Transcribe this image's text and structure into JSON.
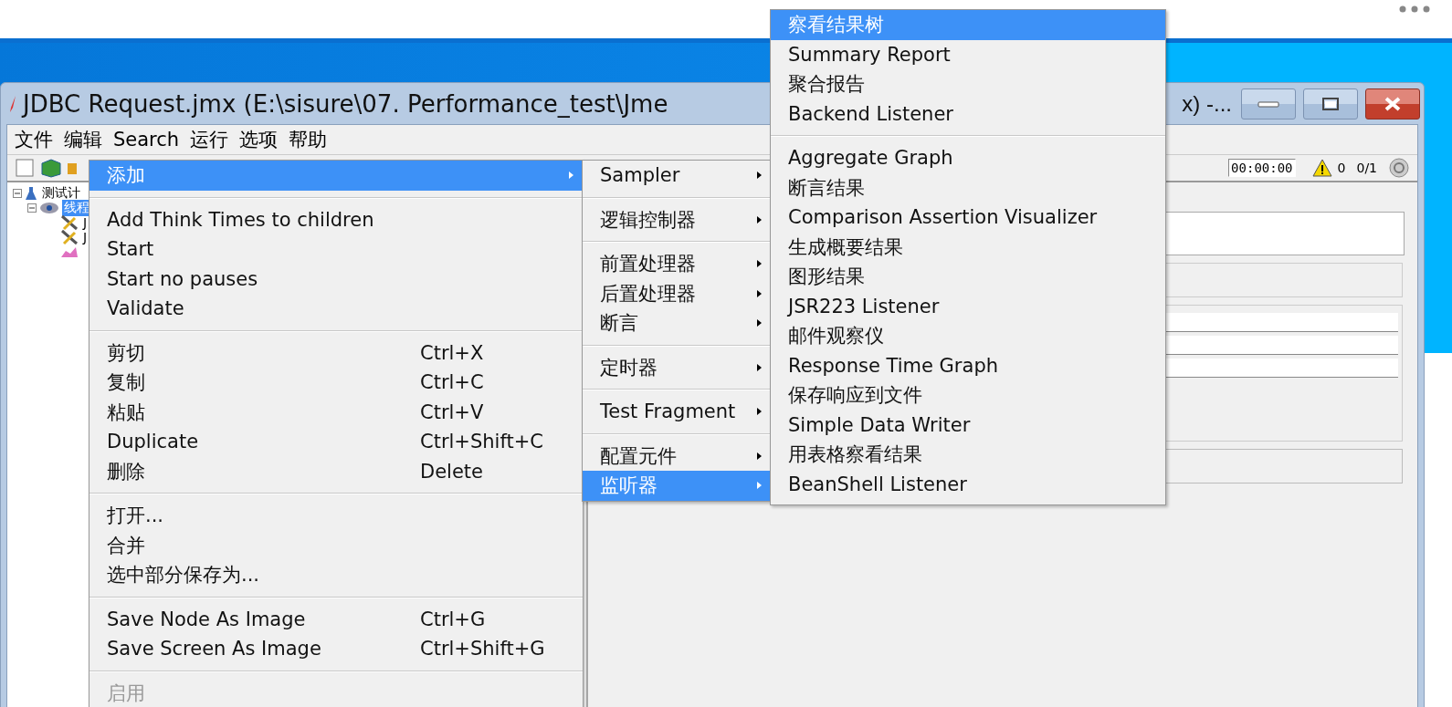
{
  "window": {
    "title": "JDBC Request.jmx (E:\\sisure\\07. Performance_test\\Jme",
    "title_tail": "x) -..."
  },
  "menubar": [
    {
      "label": "文件"
    },
    {
      "label": "编辑"
    },
    {
      "label": "Search"
    },
    {
      "label": "运行"
    },
    {
      "label": "选项"
    },
    {
      "label": "帮助"
    }
  ],
  "toolbar": {
    "timer": "00:00:00",
    "warnings": "0",
    "threads": "0/1"
  },
  "tree": [
    {
      "kind": "plan",
      "label": "测试计",
      "selected": false,
      "children": [
        {
          "kind": "thread-group",
          "label": "线程",
          "selected": true,
          "children": [
            {
              "kind": "tool",
              "label": "J"
            },
            {
              "kind": "tool",
              "label": "J"
            },
            {
              "kind": "chart"
            }
          ]
        }
      ]
    }
  ],
  "context_menu": {
    "groups": [
      [
        {
          "label": "添加",
          "has_submenu": true,
          "selected": true,
          "disabled": false
        }
      ],
      [
        {
          "label": "Add Think Times to children",
          "has_submenu": false,
          "selected": false,
          "disabled": false
        },
        {
          "label": "Start",
          "has_submenu": false,
          "selected": false,
          "disabled": false
        },
        {
          "label": "Start no pauses",
          "has_submenu": false,
          "selected": false,
          "disabled": false
        },
        {
          "label": "Validate",
          "has_submenu": false,
          "selected": false,
          "disabled": false
        }
      ],
      [
        {
          "label": "剪切",
          "shortcut": "Ctrl+X",
          "has_submenu": false,
          "selected": false,
          "disabled": false
        },
        {
          "label": "复制",
          "shortcut": "Ctrl+C",
          "has_submenu": false,
          "selected": false,
          "disabled": false
        },
        {
          "label": "粘贴",
          "shortcut": "Ctrl+V",
          "has_submenu": false,
          "selected": false,
          "disabled": false
        },
        {
          "label": "Duplicate",
          "shortcut": "Ctrl+Shift+C",
          "has_submenu": false,
          "selected": false,
          "disabled": false
        },
        {
          "label": "删除",
          "shortcut": "Delete",
          "has_submenu": false,
          "selected": false,
          "disabled": false
        }
      ],
      [
        {
          "label": "打开...",
          "has_submenu": false,
          "selected": false,
          "disabled": false
        },
        {
          "label": "合并",
          "has_submenu": false,
          "selected": false,
          "disabled": false
        },
        {
          "label": "选中部分保存为...",
          "has_submenu": false,
          "selected": false,
          "disabled": false
        }
      ],
      [
        {
          "label": "Save Node As Image",
          "shortcut": "Ctrl+G",
          "has_submenu": false,
          "selected": false,
          "disabled": false
        },
        {
          "label": "Save Screen As Image",
          "shortcut": "Ctrl+Shift+G",
          "has_submenu": false,
          "selected": false,
          "disabled": false
        }
      ],
      [
        {
          "label": "启用",
          "has_submenu": false,
          "selected": false,
          "disabled": true
        }
      ]
    ]
  },
  "add_submenu": {
    "groups": [
      [
        {
          "label": "Sampler",
          "selected": false
        }
      ],
      [
        {
          "label": "逻辑控制器",
          "selected": false
        }
      ],
      [
        {
          "label": "前置处理器",
          "selected": false
        },
        {
          "label": "后置处理器",
          "selected": false
        },
        {
          "label": "断言",
          "selected": false
        }
      ],
      [
        {
          "label": "定时器",
          "selected": false
        }
      ],
      [
        {
          "label": "Test Fragment",
          "selected": false
        }
      ],
      [
        {
          "label": "配置元件",
          "selected": false
        },
        {
          "label": "监听器",
          "selected": true
        }
      ]
    ]
  },
  "listener_submenu": {
    "groups": [
      [
        {
          "label": "察看结果树",
          "selected": true
        },
        {
          "label": "Summary Report",
          "selected": false
        },
        {
          "label": "聚合报告",
          "selected": false
        },
        {
          "label": "Backend Listener",
          "selected": false
        }
      ],
      [
        {
          "label": "Aggregate Graph",
          "selected": false
        },
        {
          "label": "断言结果",
          "selected": false
        },
        {
          "label": "Comparison Assertion Visualizer",
          "selected": false
        },
        {
          "label": "生成概要结果",
          "selected": false
        },
        {
          "label": "图形结果",
          "selected": false
        },
        {
          "label": "JSR223 Listener",
          "selected": false
        },
        {
          "label": "邮件观察仪",
          "selected": false
        },
        {
          "label": "Response Time Graph",
          "selected": false
        },
        {
          "label": "保存响应到文件",
          "selected": false
        },
        {
          "label": "Simple Data Writer",
          "selected": false
        },
        {
          "label": "用表格察看结果",
          "selected": false
        },
        {
          "label": "BeanShell Listener",
          "selected": false
        }
      ]
    ]
  }
}
